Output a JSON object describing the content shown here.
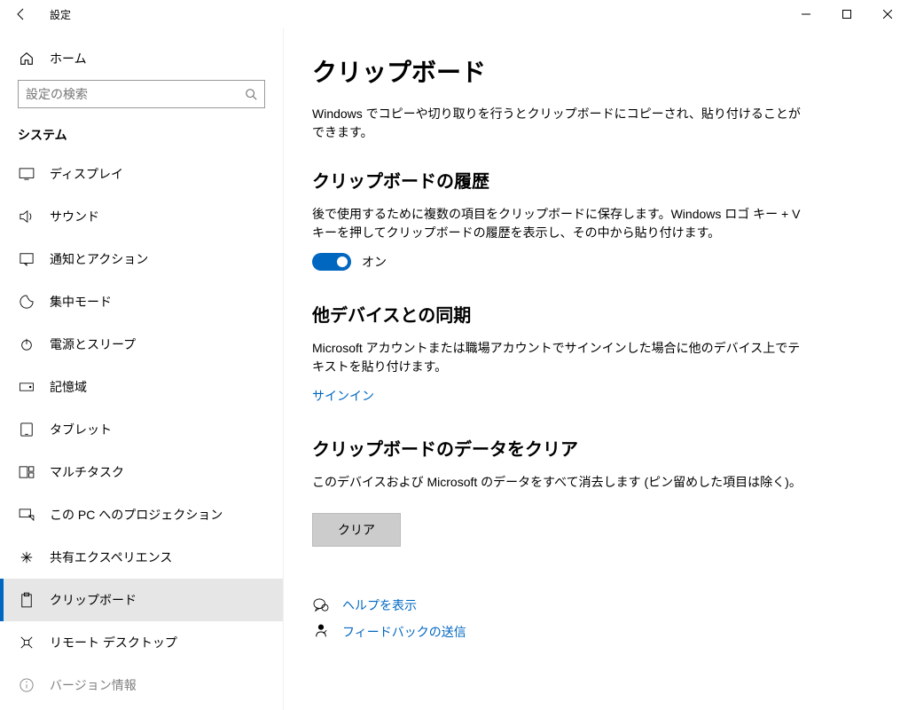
{
  "titlebar": {
    "app": "設定"
  },
  "sidebar": {
    "home": "ホーム",
    "search_placeholder": "設定の検索",
    "group": "システム",
    "items": [
      {
        "label": "ディスプレイ",
        "icon": "display-icon"
      },
      {
        "label": "サウンド",
        "icon": "sound-icon"
      },
      {
        "label": "通知とアクション",
        "icon": "notification-icon"
      },
      {
        "label": "集中モード",
        "icon": "focus-icon"
      },
      {
        "label": "電源とスリープ",
        "icon": "power-icon"
      },
      {
        "label": "記憶域",
        "icon": "storage-icon"
      },
      {
        "label": "タブレット",
        "icon": "tablet-icon"
      },
      {
        "label": "マルチタスク",
        "icon": "multitask-icon"
      },
      {
        "label": "この PC へのプロジェクション",
        "icon": "project-icon"
      },
      {
        "label": "共有エクスペリエンス",
        "icon": "shared-icon"
      },
      {
        "label": "クリップボード",
        "icon": "clipboard-icon",
        "selected": true
      },
      {
        "label": "リモート デスクトップ",
        "icon": "remote-icon"
      },
      {
        "label": "バージョン情報",
        "icon": "about-icon"
      }
    ]
  },
  "content": {
    "title": "クリップボード",
    "intro": "Windows でコピーや切り取りを行うとクリップボードにコピーされ、貼り付けることができます。",
    "history": {
      "heading": "クリップボードの履歴",
      "desc": "後で使用するために複数の項目をクリップボードに保存します。Windows ロゴ キー + V キーを押してクリップボードの履歴を表示し、その中から貼り付けます。",
      "toggle_label": "オン",
      "toggle_on": true
    },
    "sync": {
      "heading": "他デバイスとの同期",
      "desc": "Microsoft アカウントまたは職場アカウントでサインインした場合に他のデバイス上でテキストを貼り付けます。",
      "link": "サインイン"
    },
    "clear": {
      "heading": "クリップボードのデータをクリア",
      "desc": "このデバイスおよび Microsoft のデータをすべて消去します (ピン留めした項目は除く)。",
      "button": "クリア"
    },
    "help": {
      "help_link": "ヘルプを表示",
      "feedback_link": "フィードバックの送信"
    }
  }
}
